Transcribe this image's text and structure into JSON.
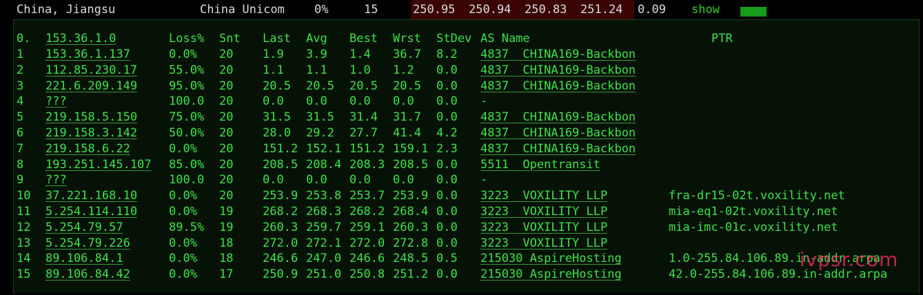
{
  "topbar": {
    "location": "China, Jiangsu",
    "isp": "China Unicom",
    "loss": "0%",
    "sent": "15",
    "values": [
      "250.95",
      "250.94",
      "250.83",
      "251.24"
    ],
    "stdev": "0.09",
    "show": "show"
  },
  "colors": {
    "text": "#3ee24a",
    "panel_bg": "#061206",
    "maroon": "#3a0404",
    "bar": "#179b1a",
    "watermark": "#ff2b6a"
  },
  "table": {
    "headers": {
      "idx": "0.",
      "host": "153.36.1.0",
      "loss": "Loss%",
      "snt": "Snt",
      "last": "Last",
      "avg": "Avg",
      "best": "Best",
      "wrst": "Wrst",
      "stdev": "StDev",
      "as": "AS Name",
      "ptr": "PTR"
    },
    "rows": [
      {
        "idx": "1",
        "host": "153.36.1.137",
        "loss": "0.0%",
        "snt": "20",
        "last": "1.9",
        "avg": "3.9",
        "best": "1.4",
        "wrst": "36.7",
        "stdev": "8.2",
        "as": "4837  CHINA169-Backbon",
        "ptr": ""
      },
      {
        "idx": "2",
        "host": "112.85.230.17",
        "loss": "55.0%",
        "snt": "20",
        "last": "1.1",
        "avg": "1.1",
        "best": "1.0",
        "wrst": "1.2",
        "stdev": "0.0",
        "as": "4837  CHINA169-Backbon",
        "ptr": ""
      },
      {
        "idx": "3",
        "host": "221.6.209.149",
        "loss": "95.0%",
        "snt": "20",
        "last": "20.5",
        "avg": "20.5",
        "best": "20.5",
        "wrst": "20.5",
        "stdev": "0.0",
        "as": "4837  CHINA169-Backbon",
        "ptr": ""
      },
      {
        "idx": "4",
        "host": "???",
        "loss": "100.0",
        "snt": "20",
        "last": "0.0",
        "avg": "0.0",
        "best": "0.0",
        "wrst": "0.0",
        "stdev": "0.0",
        "as": "-",
        "ptr": ""
      },
      {
        "idx": "5",
        "host": "219.158.5.150",
        "loss": "75.0%",
        "snt": "20",
        "last": "31.5",
        "avg": "31.5",
        "best": "31.4",
        "wrst": "31.7",
        "stdev": "0.0",
        "as": "4837  CHINA169-Backbon",
        "ptr": ""
      },
      {
        "idx": "6",
        "host": "219.158.3.142",
        "loss": "50.0%",
        "snt": "20",
        "last": "28.0",
        "avg": "29.2",
        "best": "27.7",
        "wrst": "41.4",
        "stdev": "4.2",
        "as": "4837  CHINA169-Backbon",
        "ptr": ""
      },
      {
        "idx": "7",
        "host": "219.158.6.22",
        "loss": "0.0%",
        "snt": "20",
        "last": "151.2",
        "avg": "152.1",
        "best": "151.2",
        "wrst": "159.1",
        "stdev": "2.3",
        "as": "4837  CHINA169-Backbon",
        "ptr": ""
      },
      {
        "idx": "8",
        "host": "193.251.145.107",
        "loss": "85.0%",
        "snt": "20",
        "last": "208.5",
        "avg": "208.4",
        "best": "208.3",
        "wrst": "208.5",
        "stdev": "0.0",
        "as": "5511  Opentransit",
        "ptr": ""
      },
      {
        "idx": "9",
        "host": "???",
        "loss": "100.0",
        "snt": "20",
        "last": "0.0",
        "avg": "0.0",
        "best": "0.0",
        "wrst": "0.0",
        "stdev": "0.0",
        "as": "-",
        "ptr": ""
      },
      {
        "idx": "10",
        "host": "37.221.168.10",
        "loss": "0.0%",
        "snt": "20",
        "last": "253.9",
        "avg": "253.8",
        "best": "253.7",
        "wrst": "253.9",
        "stdev": "0.0",
        "as": "3223  VOXILITY LLP",
        "ptr": "fra-dr15-02t.voxility.net"
      },
      {
        "idx": "11",
        "host": "5.254.114.110",
        "loss": "0.0%",
        "snt": "19",
        "last": "268.2",
        "avg": "268.3",
        "best": "268.2",
        "wrst": "268.4",
        "stdev": "0.0",
        "as": "3223  VOXILITY LLP",
        "ptr": "mia-eq1-02t.voxility.net"
      },
      {
        "idx": "12",
        "host": "5.254.79.57",
        "loss": "89.5%",
        "snt": "19",
        "last": "260.3",
        "avg": "259.7",
        "best": "259.1",
        "wrst": "260.3",
        "stdev": "0.0",
        "as": "3223  VOXILITY LLP",
        "ptr": "mia-imc-01c.voxility.net"
      },
      {
        "idx": "13",
        "host": "5.254.79.226",
        "loss": "0.0%",
        "snt": "18",
        "last": "272.0",
        "avg": "272.1",
        "best": "272.0",
        "wrst": "272.8",
        "stdev": "0.0",
        "as": "3223  VOXILITY LLP",
        "ptr": ""
      },
      {
        "idx": "14",
        "host": "89.106.84.1",
        "loss": "0.0%",
        "snt": "18",
        "last": "246.6",
        "avg": "247.0",
        "best": "246.6",
        "wrst": "248.5",
        "stdev": "0.5",
        "as": "215030 AspireHosting",
        "ptr": "1.0-255.84.106.89.in-addr.arpa"
      },
      {
        "idx": "15",
        "host": "89.106.84.42",
        "loss": "0.0%",
        "snt": "17",
        "last": "250.9",
        "avg": "251.0",
        "best": "250.8",
        "wrst": "251.2",
        "stdev": "0.0",
        "as": "215030 AspireHosting",
        "ptr": "42.0-255.84.106.89.in-addr.arpa"
      }
    ]
  },
  "watermark": "ivpsr.com"
}
